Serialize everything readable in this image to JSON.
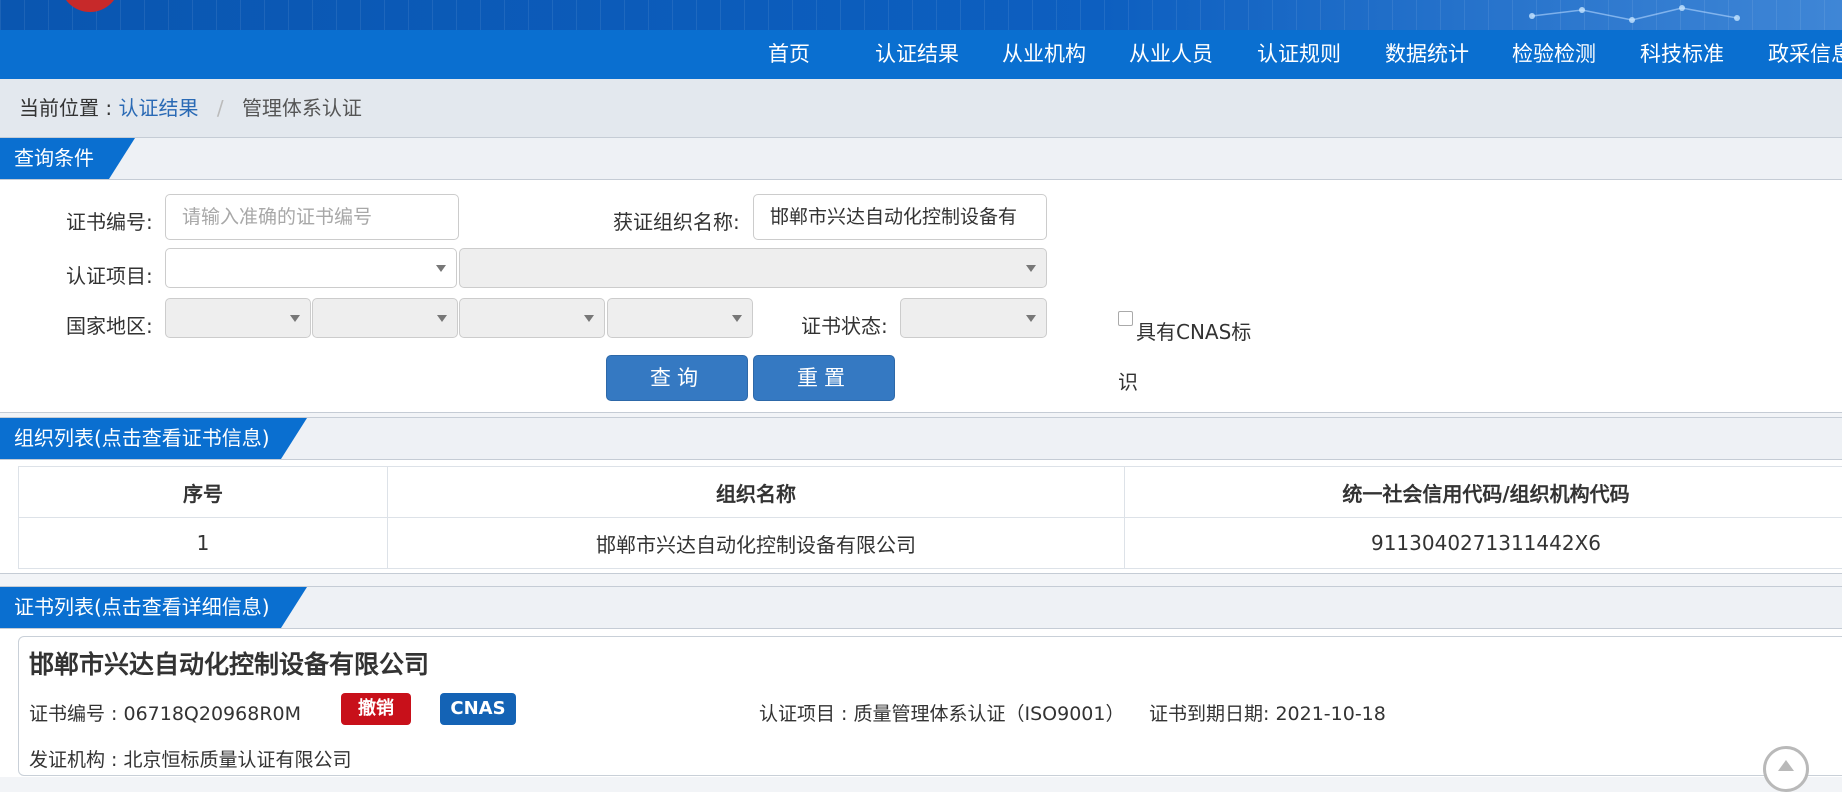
{
  "nav": {
    "items": [
      "首页",
      "认证结果",
      "从业机构",
      "从业人员",
      "认证规则",
      "数据统计",
      "检验检测",
      "科技标准",
      "政采信息"
    ]
  },
  "breadcrumb": {
    "prefix": "当前位置 :",
    "link": "认证结果",
    "separator": "/",
    "current": "管理体系认证"
  },
  "query": {
    "title": "查询条件",
    "cert_no_label": "证书编号:",
    "cert_no_placeholder": "请输入准确的证书编号",
    "org_name_label": "获证组织名称:",
    "org_name_value": "邯郸市兴达自动化控制设备有",
    "cert_item_label": "认证项目:",
    "region_label": "国家地区:",
    "status_label": "证书状态:",
    "cnas_label": "具有CNAS标识",
    "search_button": "查询",
    "reset_button": "重置"
  },
  "org_list": {
    "title": "组织列表(点击查看证书信息)",
    "columns": [
      "序号",
      "组织名称",
      "统一社会信用代码/组织机构代码"
    ],
    "rows": [
      [
        "1",
        "邯郸市兴达自动化控制设备有限公司",
        "9113040271311442X6"
      ]
    ]
  },
  "cert_list": {
    "title": "证书列表(点击查看详细信息)",
    "card": {
      "org_name": "邯郸市兴达自动化控制设备有限公司",
      "cert_no": "证书编号 : 06718Q20968R0M",
      "status_badge": "撤销",
      "cnas_badge": "CNAS",
      "cert_item": "认证项目 : 质量管理体系认证（ISO9001）",
      "expiry": "证书到期日期: 2021-10-18",
      "issuer": "发证机构 : 北京恒标质量认证有限公司"
    }
  },
  "colors": {
    "nav_bg": "#0a6fd0",
    "button_bg": "#3579c2",
    "badge_red": "#c8101a",
    "badge_blue": "#1463b5",
    "link": "#2a6ab5"
  }
}
